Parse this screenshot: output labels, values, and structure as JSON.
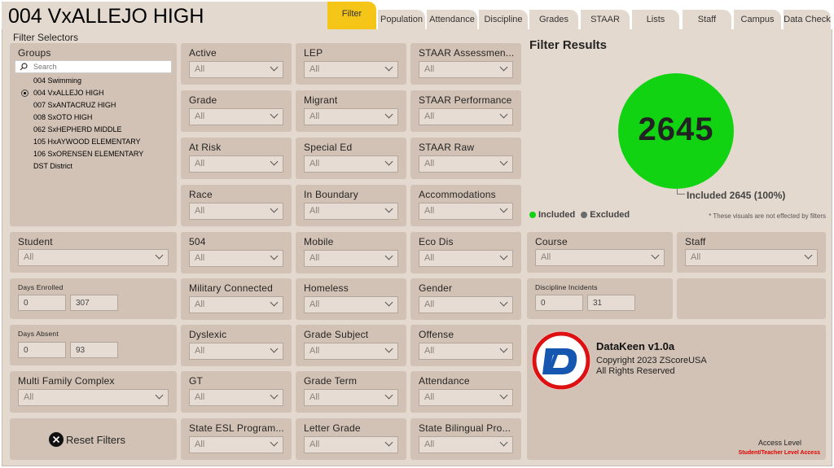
{
  "title": "004 VxALLEJO HIGH",
  "tabs": [
    "Filter",
    "Population",
    "Attendance",
    "Discipline",
    "Grades",
    "STAAR",
    "Lists",
    "Staff",
    "Campus",
    "Data Check"
  ],
  "filter_selectors_label": "Filter Selectors",
  "groups": {
    "label": "Groups",
    "search_placeholder": "Search",
    "items": [
      "004 Swimming",
      "004 VxALLEJO HIGH",
      "007 SxANTACRUZ HIGH",
      "008 SxOTO HIGH",
      "062 SxHEPHERD MIDDLE",
      "105 HxAYWOOD ELEMENTARY",
      "106 SxORENSEN ELEMENTARY",
      "DST District"
    ],
    "selected_index": 1
  },
  "slicers": {
    "active": "Active",
    "lep": "LEP",
    "staar_assess": "STAAR Assessmen...",
    "grade": "Grade",
    "migrant": "Migrant",
    "staar_perf": "STAAR Performance",
    "at_risk": "At Risk",
    "special_ed": "Special Ed",
    "staar_raw": "STAAR Raw",
    "race": "Race",
    "in_boundary": "In Boundary",
    "accommodations": "Accommodations",
    "student": "Student",
    "s504": "504",
    "mobile": "Mobile",
    "eco_dis": "Eco Dis",
    "military": "Military Connected",
    "homeless": "Homeless",
    "gender": "Gender",
    "dyslexic": "Dyslexic",
    "grade_subject": "Grade Subject",
    "offense": "Offense",
    "multi_family": "Multi Family Complex",
    "gt": "GT",
    "grade_term": "Grade Term",
    "attendance": "Attendance",
    "state_esl": "State ESL Program...",
    "letter_grade": "Letter Grade",
    "state_bilingual": "State Bilingual Pro...",
    "course": "Course",
    "staff": "Staff"
  },
  "all_value": "All",
  "days_enrolled": {
    "label": "Days Enrolled",
    "min": "0",
    "max": "307"
  },
  "days_absent": {
    "label": "Days Absent",
    "min": "0",
    "max": "93"
  },
  "discipline_incidents": {
    "label": "Discipline Incidents",
    "min": "0",
    "max": "31"
  },
  "reset_label": "Reset Filters",
  "results": {
    "title": "Filter Results",
    "count": "2645",
    "included_label": "Included 2645 (100%)",
    "legend_included": "Included",
    "legend_excluded": "Excluded",
    "note": "* These visuals are not effected by filters",
    "included_color": "#12d312",
    "excluded_color": "#6b6b6b"
  },
  "brand": {
    "name": "DataKeen v1.0a",
    "copyright": "Copyright 2023 ZScoreUSA",
    "rights": "All Rights Reserved",
    "access_label": "Access Level",
    "access_value": "Student/Teacher Level Access"
  }
}
